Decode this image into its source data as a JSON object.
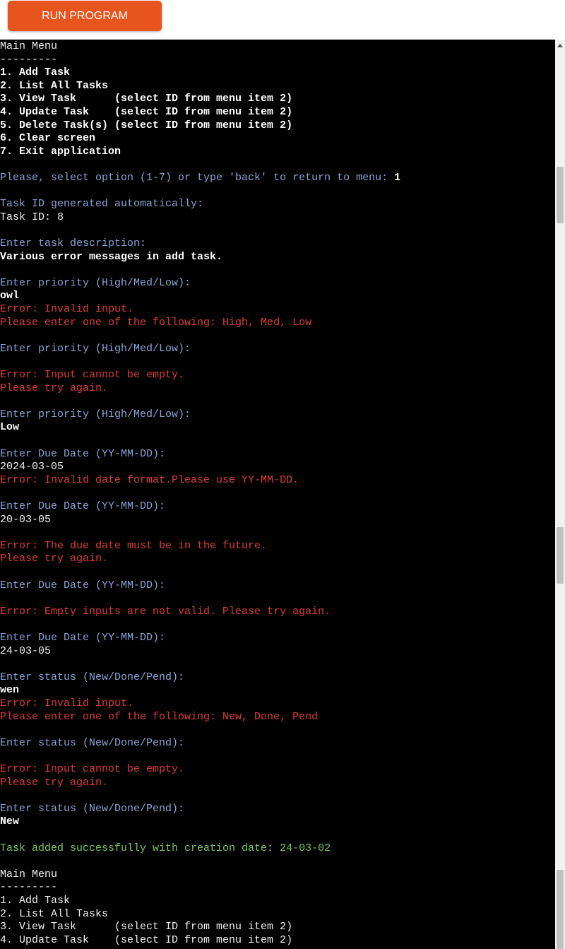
{
  "toolbar": {
    "run_label": "RUN PROGRAM",
    "run_color": "#e8541e"
  },
  "terminal": {
    "lines": [
      {
        "text": "Main Menu",
        "style": "plain"
      },
      {
        "text": "---------",
        "style": "plain"
      },
      {
        "text": "1. Add Task",
        "style": "bold"
      },
      {
        "text": "2. List All Tasks",
        "style": "bold"
      },
      {
        "text": "3. View Task      (select ID from menu item 2)",
        "style": "bold"
      },
      {
        "text": "4. Update Task    (select ID from menu item 2)",
        "style": "bold"
      },
      {
        "text": "5. Delete Task(s) (select ID from menu item 2)",
        "style": "bold"
      },
      {
        "text": "6. Clear screen",
        "style": "bold"
      },
      {
        "text": "7. Exit application",
        "style": "bold"
      },
      {
        "text": "",
        "style": "plain"
      },
      {
        "text": "Please, select option (1-7) or type 'back' to return to menu: ",
        "style": "prompt",
        "input": "1"
      },
      {
        "text": "",
        "style": "plain"
      },
      {
        "text": "Task ID generated automatically:",
        "style": "prompt"
      },
      {
        "text": "Task ID: 8",
        "style": "plain"
      },
      {
        "text": "",
        "style": "plain"
      },
      {
        "text": "Enter task description:",
        "style": "prompt"
      },
      {
        "text": "Various error messages in add task.",
        "style": "input"
      },
      {
        "text": "",
        "style": "plain"
      },
      {
        "text": "Enter priority (High/Med/Low):",
        "style": "prompt"
      },
      {
        "text": "owl",
        "style": "input"
      },
      {
        "text": "Error: Invalid input.",
        "style": "error"
      },
      {
        "text": "Please enter one of the following: High, Med, Low",
        "style": "error"
      },
      {
        "text": "",
        "style": "plain"
      },
      {
        "text": "Enter priority (High/Med/Low):",
        "style": "prompt"
      },
      {
        "text": "",
        "style": "plain"
      },
      {
        "text": "Error: Input cannot be empty.",
        "style": "error"
      },
      {
        "text": "Please try again.",
        "style": "error"
      },
      {
        "text": "",
        "style": "plain"
      },
      {
        "text": "Enter priority (High/Med/Low):",
        "style": "prompt"
      },
      {
        "text": "Low",
        "style": "input"
      },
      {
        "text": "",
        "style": "plain"
      },
      {
        "text": "Enter Due Date (YY-MM-DD):",
        "style": "prompt"
      },
      {
        "text": "2024-03-05",
        "style": "plain"
      },
      {
        "text": "Error: Invalid date format.Please use YY-MM-DD.",
        "style": "error"
      },
      {
        "text": "",
        "style": "plain"
      },
      {
        "text": "Enter Due Date (YY-MM-DD):",
        "style": "prompt"
      },
      {
        "text": "20-03-05",
        "style": "plain"
      },
      {
        "text": "",
        "style": "plain"
      },
      {
        "text": "Error: The due date must be in the future.",
        "style": "error"
      },
      {
        "text": "Please try again.",
        "style": "error"
      },
      {
        "text": "",
        "style": "plain"
      },
      {
        "text": "Enter Due Date (YY-MM-DD):",
        "style": "prompt"
      },
      {
        "text": "",
        "style": "plain"
      },
      {
        "text": "Error: Empty inputs are not valid. Please try again.",
        "style": "error"
      },
      {
        "text": "",
        "style": "plain"
      },
      {
        "text": "Enter Due Date (YY-MM-DD):",
        "style": "prompt"
      },
      {
        "text": "24-03-05",
        "style": "plain"
      },
      {
        "text": "",
        "style": "plain"
      },
      {
        "text": "Enter status (New/Done/Pend):",
        "style": "prompt"
      },
      {
        "text": "wen",
        "style": "input"
      },
      {
        "text": "Error: Invalid input.",
        "style": "error"
      },
      {
        "text": "Please enter one of the following: New, Done, Pend",
        "style": "error"
      },
      {
        "text": "",
        "style": "plain"
      },
      {
        "text": "Enter status (New/Done/Pend):",
        "style": "prompt"
      },
      {
        "text": "",
        "style": "plain"
      },
      {
        "text": "Error: Input cannot be empty.",
        "style": "error"
      },
      {
        "text": "Please try again.",
        "style": "error"
      },
      {
        "text": "",
        "style": "plain"
      },
      {
        "text": "Enter status (New/Done/Pend):",
        "style": "prompt"
      },
      {
        "text": "New",
        "style": "input"
      },
      {
        "text": "",
        "style": "plain"
      },
      {
        "text": "Task added successfully with creation date: 24-03-02",
        "style": "success"
      },
      {
        "text": "",
        "style": "plain"
      },
      {
        "text": "Main Menu",
        "style": "plain"
      },
      {
        "text": "---------",
        "style": "plain"
      },
      {
        "text": "1. Add Task",
        "style": "plain"
      },
      {
        "text": "2. List All Tasks",
        "style": "plain"
      },
      {
        "text": "3. View Task      (select ID from menu item 2)",
        "style": "plain"
      },
      {
        "text": "4. Update Task    (select ID from menu item 2)",
        "style": "plain"
      }
    ]
  }
}
